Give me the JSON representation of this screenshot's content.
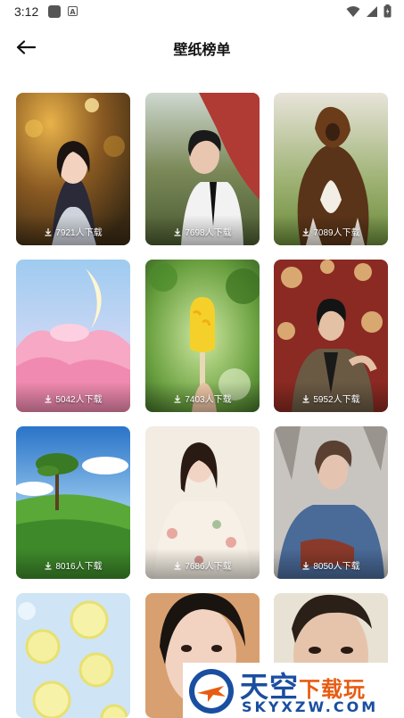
{
  "status_bar": {
    "time": "3:12",
    "notification_badge": "A"
  },
  "header": {
    "title": "壁纸榜单"
  },
  "wallpapers": [
    {
      "downloads": "7921人下载",
      "theme": "woman-bokeh-orange"
    },
    {
      "downloads": "7698人下载",
      "theme": "man-suit-outdoor"
    },
    {
      "downloads": "7089人下载",
      "theme": "long-haired-dog"
    },
    {
      "downloads": "5042人下载",
      "theme": "pink-clouds-moon"
    },
    {
      "downloads": "7403人下载",
      "theme": "yellow-popsicle-leaves"
    },
    {
      "downloads": "5952人下载",
      "theme": "man-floral-wallpaper"
    },
    {
      "downloads": "8016人下载",
      "theme": "tree-green-hill"
    },
    {
      "downloads": "7686人下载",
      "theme": "girl-floral-dress"
    },
    {
      "downloads": "8050人下载",
      "theme": "man-denim-jacket"
    },
    {
      "downloads": "",
      "theme": "lemon-slices-ice"
    },
    {
      "downloads": "",
      "theme": "girl-closeup"
    },
    {
      "downloads": "",
      "theme": "man-closeup"
    }
  ],
  "watermark": {
    "brand": "天空",
    "brand_accent": "下载玩",
    "site": "SKYXZW.COM"
  }
}
